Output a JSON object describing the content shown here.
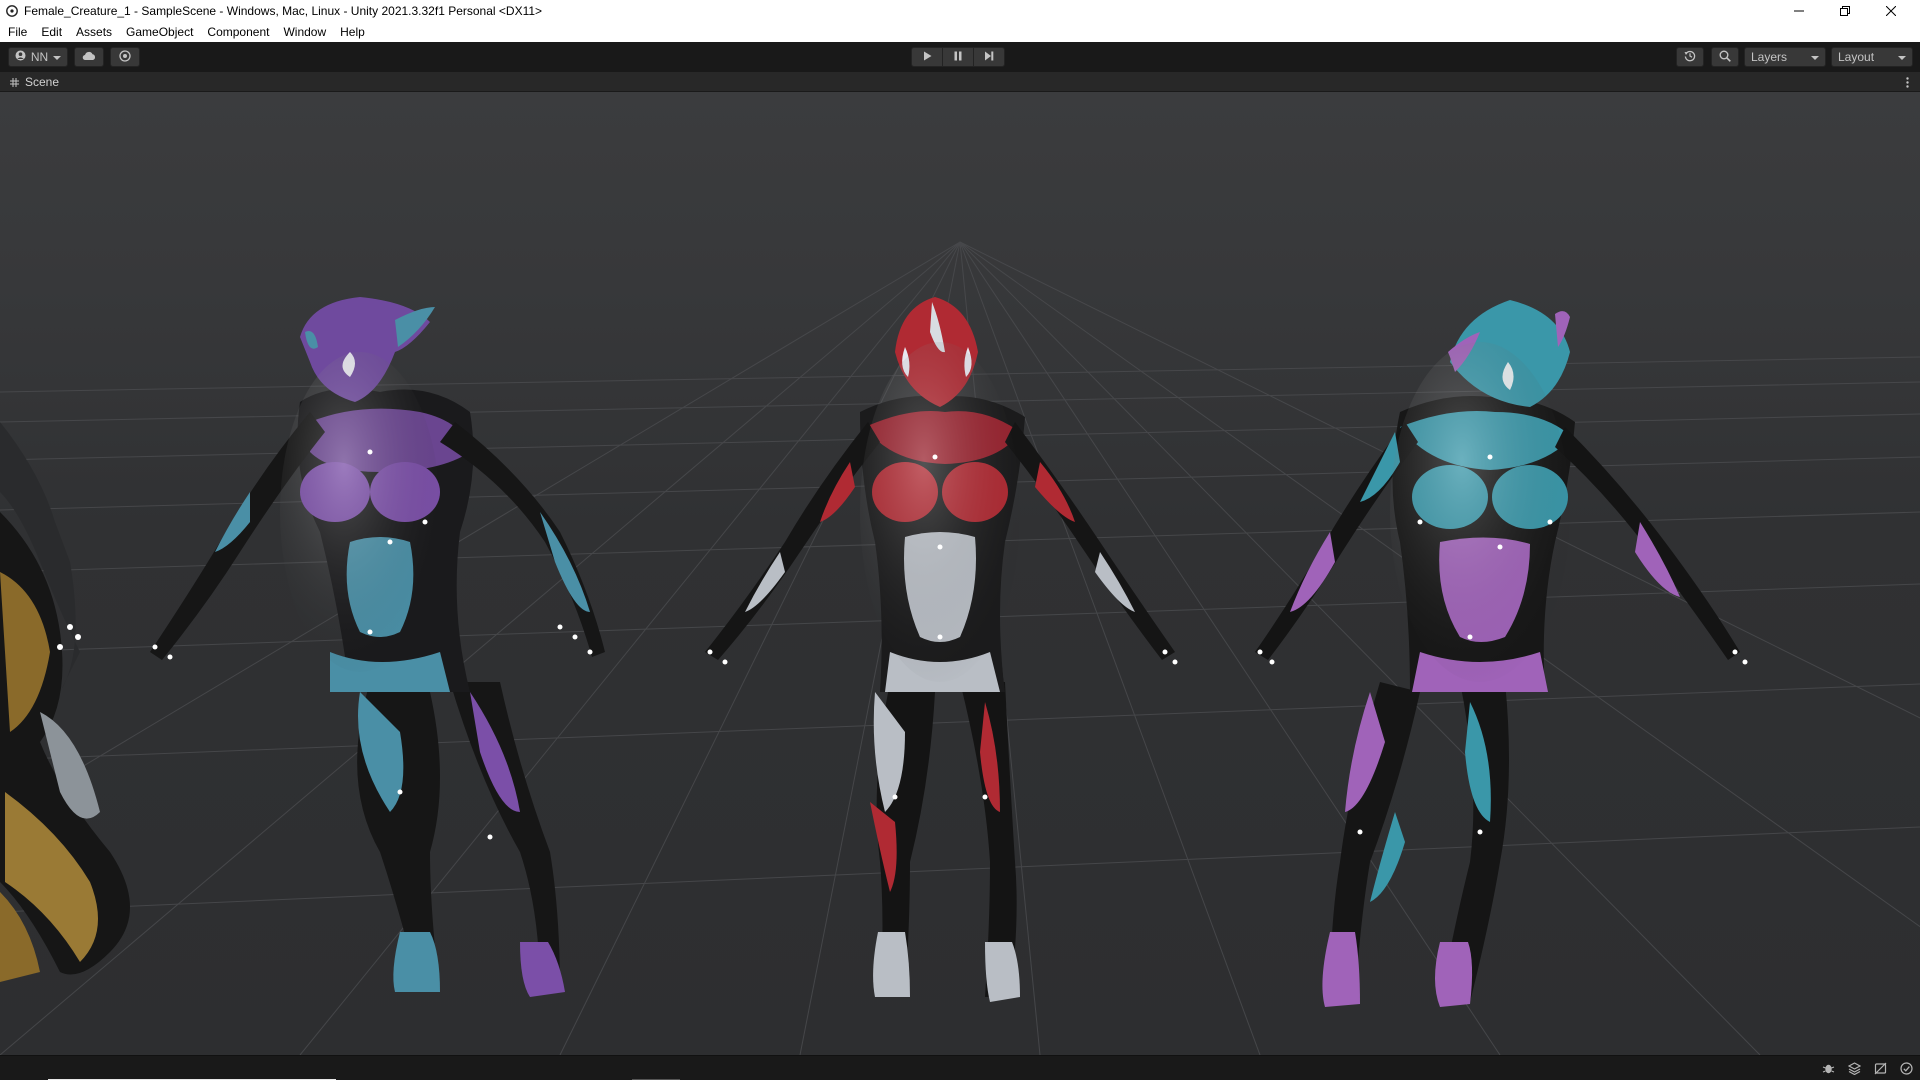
{
  "window": {
    "title": "Female_Creature_1 - SampleScene - Windows, Mac, Linux - Unity 2021.3.32f1 Personal <DX11>",
    "controls": [
      "minimize-icon",
      "restore-icon",
      "close-icon"
    ]
  },
  "menu": {
    "items": [
      "File",
      "Edit",
      "Assets",
      "GameObject",
      "Component",
      "Window",
      "Help"
    ]
  },
  "toolbar": {
    "account_label": "NN",
    "layers_label": "Layers",
    "layout_label": "Layout",
    "play_controls": [
      "play-icon",
      "pause-icon",
      "step-icon"
    ]
  },
  "scene_tab": {
    "label": "Scene"
  },
  "scene": {
    "characters": [
      {
        "name": "partial-left-gold",
        "colors": [
          "#8a6a2a",
          "#9aa3ab",
          "#151515"
        ]
      },
      {
        "name": "purple-teal",
        "colors": [
          "#7b4fa8",
          "#4a8fa6",
          "#141414"
        ]
      },
      {
        "name": "red-silver",
        "colors": [
          "#b02a33",
          "#b9bec5",
          "#131313"
        ]
      },
      {
        "name": "teal-purple",
        "colors": [
          "#3a97a9",
          "#a063b9",
          "#151515"
        ]
      }
    ]
  },
  "colors": {
    "toolbar_bg": "#191919",
    "viewport_bg": "#333436",
    "grid": "#4e4f52"
  }
}
